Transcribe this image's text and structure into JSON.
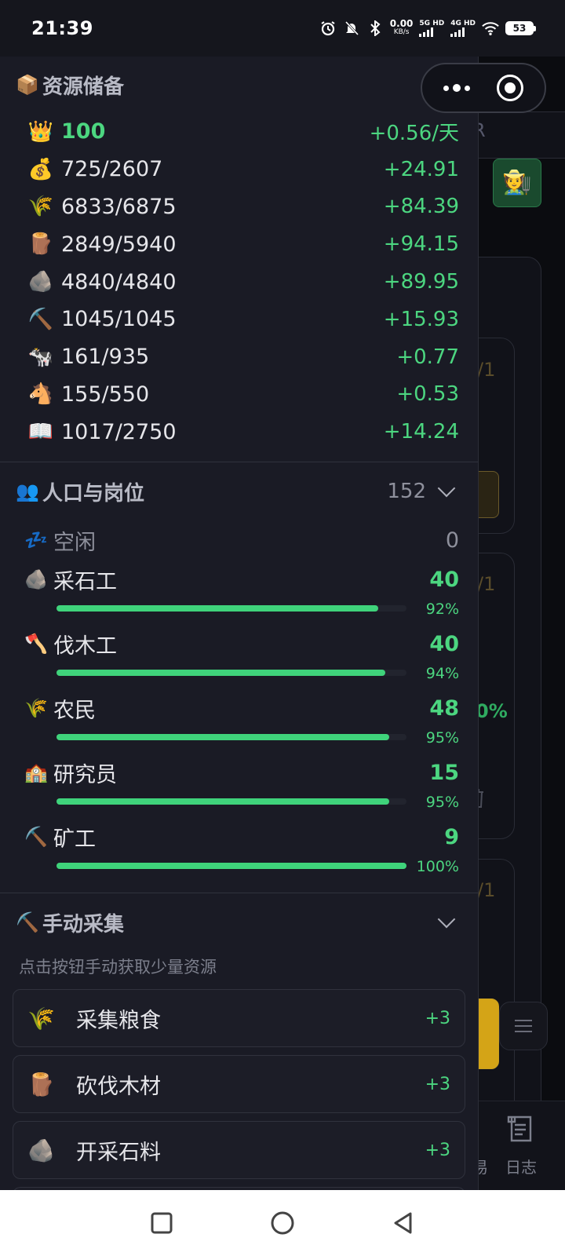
{
  "status_bar": {
    "time": "21:39",
    "speed_value": "0.00",
    "speed_unit": "KB/s",
    "net1": "5G HD",
    "net2": "4G HD",
    "battery": "53"
  },
  "resources": {
    "title": "资源储备",
    "items": [
      {
        "icon": "👑",
        "value": "100",
        "rate": "+0.56/天"
      },
      {
        "icon": "💰",
        "value": "725/2607",
        "rate": "+24.91"
      },
      {
        "icon": "🌾",
        "value": "6833/6875",
        "rate": "+84.39"
      },
      {
        "icon": "🪵",
        "value": "2849/5940",
        "rate": "+94.15"
      },
      {
        "icon": "🪨",
        "value": "4840/4840",
        "rate": "+89.95"
      },
      {
        "icon": "⛏️",
        "value": "1045/1045",
        "rate": "+15.93"
      },
      {
        "icon": "🐄",
        "value": "161/935",
        "rate": "+0.77"
      },
      {
        "icon": "🐴",
        "value": "155/550",
        "rate": "+0.53"
      },
      {
        "icon": "📖",
        "value": "1017/2750",
        "rate": "+14.24"
      }
    ]
  },
  "population": {
    "title": "人口与岗位",
    "total": "152",
    "idle": {
      "icon": "💤",
      "label": "空闲",
      "count": "0"
    },
    "jobs": [
      {
        "icon": "🪨",
        "label": "采石工",
        "count": "40",
        "percent": "92%",
        "fill": 0.92
      },
      {
        "icon": "🪓",
        "label": "伐木工",
        "count": "40",
        "percent": "94%",
        "fill": 0.94
      },
      {
        "icon": "🌾",
        "label": "农民",
        "count": "48",
        "percent": "95%",
        "fill": 0.95
      },
      {
        "icon": "🏫",
        "label": "研究员",
        "count": "15",
        "percent": "95%",
        "fill": 0.95
      },
      {
        "icon": "⛏️",
        "label": "矿工",
        "count": "9",
        "percent": "100%",
        "fill": 1.0
      }
    ]
  },
  "manual": {
    "title": "手动采集",
    "hint": "点击按钮手动获取少量资源",
    "buttons": [
      {
        "icon": "🌾",
        "label": "采集粮食",
        "value": "+3"
      },
      {
        "icon": "🪵",
        "label": "砍伐木材",
        "value": "+3"
      },
      {
        "icon": "🪨",
        "label": "开采石料",
        "value": "+3"
      }
    ]
  },
  "background": {
    "partial_a": "/1",
    "partial_b": "/1",
    "partial_c": "/1",
    "partial_percent": "0%",
    "nav_trade": "易",
    "nav_log": "日志",
    "title_fragment": "R"
  },
  "colors": {
    "accent_green": "#4cd680",
    "panel_bg": "#1a1b25",
    "bar_green": "#3fd37b"
  }
}
